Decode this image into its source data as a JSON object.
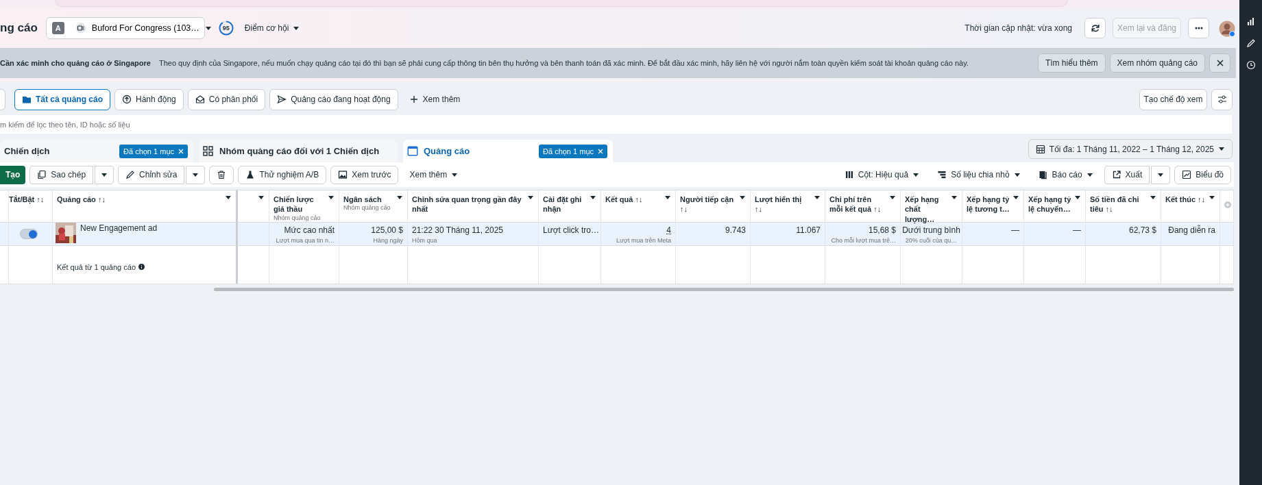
{
  "header": {
    "title": "ng cáo",
    "account": {
      "initial": "A",
      "name": "Buford For Congress (103…"
    },
    "opportunity": {
      "score": "95",
      "label": "Điểm cơ hội"
    },
    "updated": "Thời gian cập nhật: vừa xong",
    "review_button": {
      "label": "Xem lại và đăng",
      "disabled": true
    }
  },
  "banner": {
    "title": "Cần xác minh cho quảng cáo ở Singapore",
    "text": "Theo quy định của Singapore, nếu muốn chạy quảng cáo tại đó thì bạn sẽ phải cung cấp thông tin bên thụ hưởng và bên thanh toán đã xác minh. Để bắt đầu xác minh, hãy liên hệ với người nắm toàn quyền kiểm soát tài khoản quảng cáo này.",
    "buttons": [
      "Tìm hiểu thêm",
      "Xem nhóm quảng cáo"
    ]
  },
  "filters": [
    {
      "label": "Tất cả quảng cáo",
      "selected": true
    },
    {
      "label": "Hành động",
      "selected": false
    },
    {
      "label": "Có phân phối",
      "selected": false
    },
    {
      "label": "Quảng cáo đang hoạt động",
      "selected": false
    }
  ],
  "more_filters": "Xem thêm",
  "create_view": "Tạo chế độ xem",
  "search": {
    "placeholder": "m kiếm để lọc theo tên, ID hoặc số liệu"
  },
  "level_tabs": [
    {
      "label": "Chiến dịch",
      "badge": "Đã chọn 1 mục",
      "selected": false
    },
    {
      "label": "Nhóm quảng cáo đối với 1 Chiến dịch",
      "selected": false
    },
    {
      "label": "Quảng cáo",
      "badge": "Đã chọn 1 mục",
      "selected": true
    }
  ],
  "date_range": "Tối đa: 1 Tháng 11, 2022 – 1 Tháng 12, 2025",
  "toolbar_left": [
    {
      "kind": "primary",
      "label": "Tạo"
    },
    {
      "kind": "split",
      "label": "Sao chép"
    },
    {
      "kind": "split",
      "label": "Chỉnh sửa"
    },
    {
      "kind": "icon"
    },
    {
      "kind": "button",
      "label": "Thử nghiệm A/B"
    },
    {
      "kind": "button",
      "label": "Xem trước"
    },
    {
      "kind": "menu",
      "label": "Xem thêm"
    }
  ],
  "toolbar_right": [
    {
      "kind": "menu",
      "label": "Cột: Hiệu quả"
    },
    {
      "kind": "menu",
      "label": "Số liệu chia nhỏ"
    },
    {
      "kind": "menu",
      "label": "Báo cáo"
    },
    {
      "kind": "split",
      "label": "Xuất"
    },
    {
      "kind": "button",
      "label": "Biểu đồ"
    }
  ],
  "table": {
    "columns": [
      {
        "label": "Tắt/Bật ↑↓"
      },
      {
        "label": "Quảng cáo ↑↓"
      },
      {},
      {
        "label": "Chiến lược giá thầu",
        "sub": "Nhóm quảng cáo"
      },
      {
        "label": "Ngân sách",
        "sub": "Nhóm quảng cáo"
      },
      {
        "label": "Chỉnh sửa quan trọng gần đây nhất"
      },
      {
        "label": "Cài đặt ghi nhận"
      },
      {
        "label": "Kết quả ↑↓"
      },
      {
        "label": "Người tiếp cận ↑↓"
      },
      {
        "label": "Lượt hiển thị ↑↓"
      },
      {
        "label": "Chi phí trên mỗi kết quả ↑↓"
      },
      {
        "label": "Xếp hạng chất lượng…"
      },
      {
        "label": "Xếp hạng tỷ lệ tương t…"
      },
      {
        "label": "Xếp hạng tỷ lệ chuyển…"
      },
      {
        "label": "Số tiền đã chi tiêu ↑↓"
      },
      {
        "label": "Kết thúc ↑↓"
      }
    ],
    "rows": [
      {
        "selected": true,
        "cells": [
          {
            "on": true
          },
          {
            "value": "New Engagement ad"
          },
          "",
          {
            "value": "Mức cao nhất",
            "sub": "Lượt mua qua tin n…"
          },
          {
            "value": "125,00 $",
            "sub": "Hàng ngày"
          },
          {
            "value": "21:22 30 Tháng 11, 2025",
            "sub": "Hôm qua"
          },
          {
            "value": "Lượt click tro…"
          },
          {
            "value": "4",
            "sub": "Lượt mua trên Meta"
          },
          {
            "value": "9.743"
          },
          {
            "value": "11.067"
          },
          {
            "value": "15,68 $",
            "sub": "Cho mỗi lượt mua trê…"
          },
          {
            "value": "Dưới trung bình",
            "sub": "20% cuối của qu…"
          },
          {
            "value": "—"
          },
          {
            "value": "—"
          },
          {
            "value": "62,73 $"
          },
          {
            "value": "Đang diễn ra"
          }
        ]
      }
    ],
    "summary": "Kết quả từ 1 quảng cáo"
  }
}
